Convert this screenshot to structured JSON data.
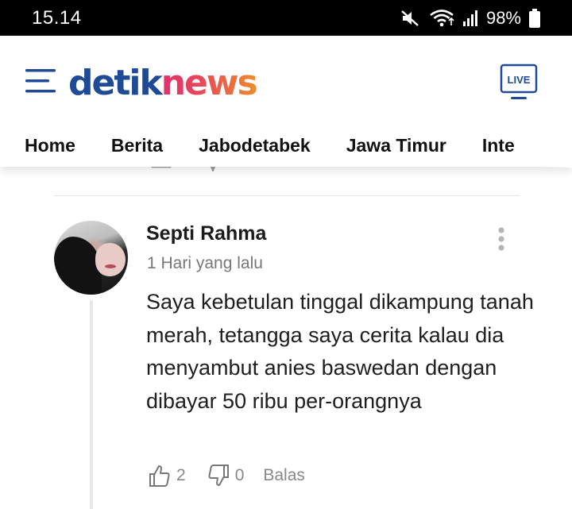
{
  "status_bar": {
    "time": "15.14",
    "battery": "98%",
    "icons": [
      "mute-icon",
      "wifi-icon",
      "signal-icon",
      "battery-icon"
    ]
  },
  "header": {
    "logo_part1": "detik",
    "logo_part2": "news",
    "live_label": "LIVE",
    "colors": {
      "brand_blue": "#1f4a95",
      "accent_pink": "#e0306e",
      "accent_orange": "#f08a2a"
    }
  },
  "nav": {
    "items": [
      "Home",
      "Berita",
      "Jabodetabek",
      "Jawa Timur",
      "Inte"
    ]
  },
  "comment": {
    "author": "Septi Rahma",
    "time_ago": "1 Hari yang lalu",
    "text": "Saya kebetulan tinggal dikampung tanah merah, tetangga saya cerita kalau dia menyambut anies baswedan dengan dibayar 50 ribu per-orangnya",
    "likes": "2",
    "dislikes": "0",
    "reply_label": "Balas"
  }
}
